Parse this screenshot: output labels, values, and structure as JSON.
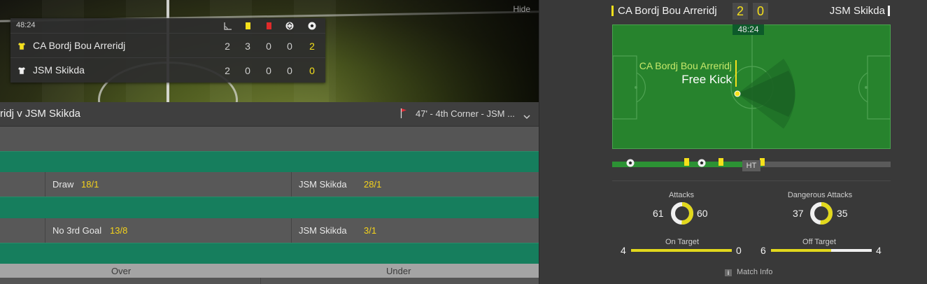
{
  "scoreboard": {
    "clock": "48:24",
    "hide_label": "Hide",
    "columns": [
      "corners-icon",
      "yellow-card-icon",
      "red-card-icon",
      "substitution-icon",
      "goals-icon"
    ],
    "teams": [
      {
        "name": "CA Bordj Bou Arreridj",
        "corners": "2",
        "yellow": "3",
        "red": "0",
        "subs": "0",
        "goals": "2",
        "shirt_color": "#f5e01b"
      },
      {
        "name": "JSM Skikda",
        "corners": "2",
        "yellow": "0",
        "red": "0",
        "subs": "0",
        "goals": "0",
        "shirt_color": "#f0f0f0"
      }
    ]
  },
  "match_bar": {
    "title": "ridj v JSM Skikda",
    "event": "47' - 4th Corner - JSM ..."
  },
  "markets": {
    "row1": {
      "draw_label": "Draw",
      "draw_price": "18/1",
      "away_label": "JSM Skikda",
      "away_price": "28/1"
    },
    "row2": {
      "no_goal_label": "No 3rd Goal",
      "no_goal_price": "13/8",
      "away_label": "JSM Skikda",
      "away_price": "3/1"
    },
    "over_label": "Over",
    "under_label": "Under"
  },
  "tracker": {
    "home_team": "CA Bordj Bou Arreridj",
    "away_team": "JSM Skikda",
    "home_score": "2",
    "away_score": "0",
    "clock": "48:24",
    "event_team": "CA Bordj Bou Arreridj",
    "event_name": "Free Kick",
    "half_time_label": "HT",
    "timeline_progress": 0.54,
    "colors": {
      "home": "#f5e01b",
      "away": "#f0f0f0",
      "pitch": "#27832d"
    }
  },
  "stats": {
    "attacks": {
      "label": "Attacks",
      "home": "61",
      "away": "60"
    },
    "dangerous": {
      "label": "Dangerous Attacks",
      "home": "37",
      "away": "35"
    },
    "on_target": {
      "label": "On Target",
      "home": "4",
      "away": "0"
    },
    "off_target": {
      "label": "Off Target",
      "home": "6",
      "away": "4"
    },
    "match_info_label": "Match Info"
  }
}
